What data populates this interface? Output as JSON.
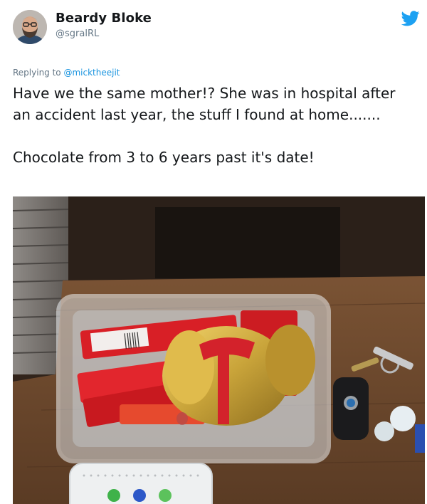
{
  "tweet": {
    "author": {
      "display_name": "Beardy Bloke",
      "handle": "@sgralRL",
      "avatar_icon": "avatar-photo"
    },
    "platform_icon": "twitter-bird-icon",
    "brand_color": "#1da1f2",
    "reply": {
      "prefix": "Replying to ",
      "mention": "@micktheejit",
      "mention_color": "#1b95e0"
    },
    "text": "Have we the same mother!? She was in hospital after an accident last year, the stuff I found at home.......\n\nChocolate from 3 to 6 years past it's date!",
    "media": {
      "type": "photo",
      "icon": "photo-of-chocolate-in-plastic-tub"
    }
  }
}
